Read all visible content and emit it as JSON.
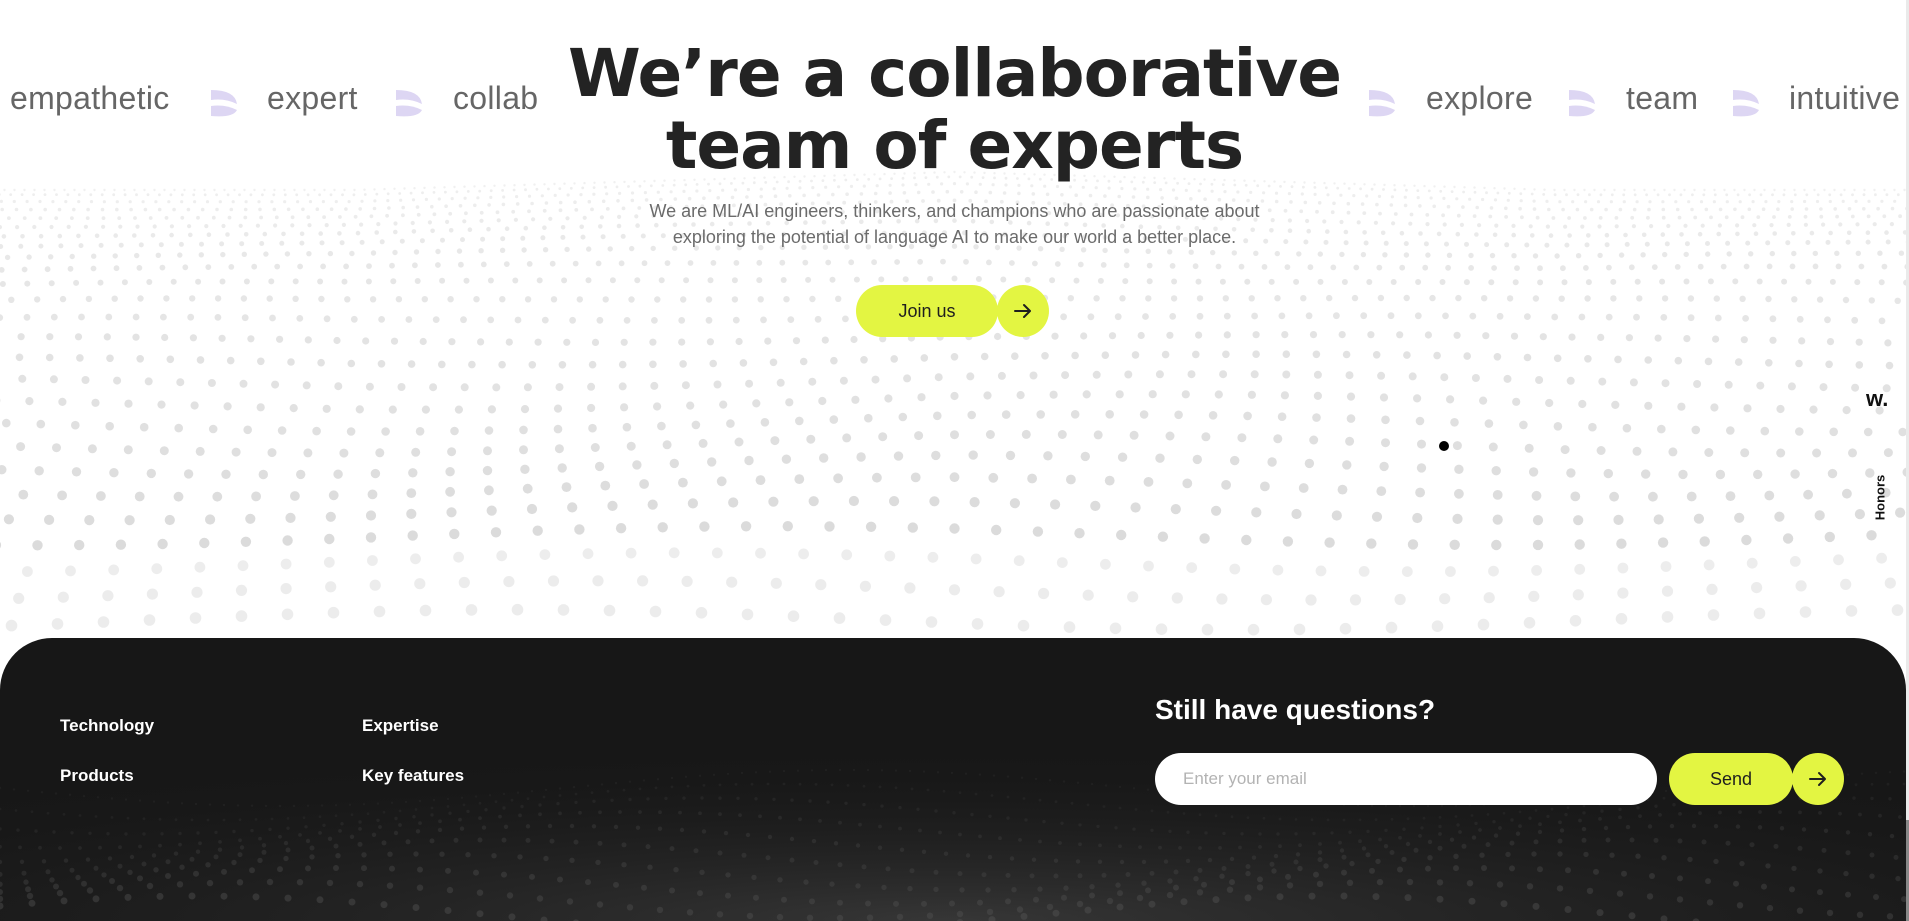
{
  "marquee": {
    "left_words": [
      "empathetic",
      "expert",
      "collab"
    ],
    "right_words": [
      "explore",
      "team",
      "intuitive"
    ]
  },
  "hero": {
    "title_line1": "We’re a collaborative",
    "title_line2": "team of experts",
    "subtitle_line1": "We are ML/AI engineers, thinkers, and champions who are passionate about",
    "subtitle_line2": "exploring the potential of language AI to make our world a better place.",
    "join_label": "Join us"
  },
  "side": {
    "logo": "w.",
    "honors_label": "Honors"
  },
  "footer": {
    "links": [
      "Technology",
      "Products",
      "Expertise",
      "Key features"
    ],
    "questions_heading": "Still have questions?",
    "email_placeholder": "Enter your email",
    "email_value": "",
    "send_label": "Send"
  },
  "colors": {
    "accent": "#e3f542",
    "footer_bg": "#171717",
    "leaf": "#ddd6f3",
    "dots": "#c8c8c8"
  },
  "icons": [
    "leaf-icon",
    "arrow-right-icon"
  ]
}
